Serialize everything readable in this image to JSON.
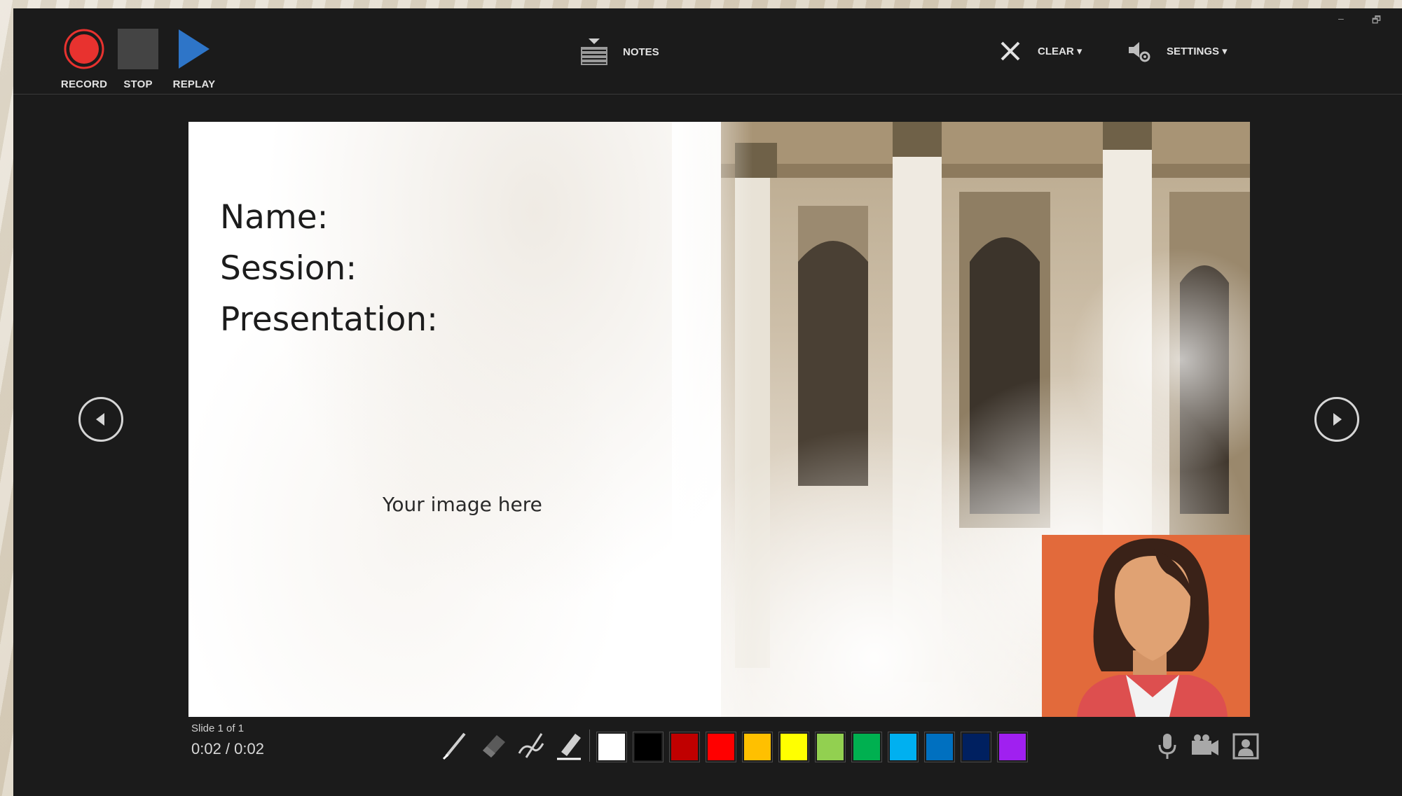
{
  "toolbar": {
    "record_label": "RECORD",
    "stop_label": "STOP",
    "replay_label": "REPLAY",
    "notes_label": "NOTES",
    "clear_label": "CLEAR ▾",
    "settings_label": "SETTINGS ▾"
  },
  "window_controls": {
    "minimize": "–",
    "restore": "🗗"
  },
  "slide": {
    "lines": [
      "Name:",
      "Session:",
      "Presentation:"
    ],
    "image_placeholder": "Your image here"
  },
  "status": {
    "slide_counter": "Slide 1 of 1",
    "time": "0:02  /  0:02"
  },
  "pen_tools": [
    "pen-icon",
    "eraser-icon",
    "laser-pointer-icon",
    "highlighter-icon"
  ],
  "ink_colors": [
    "#ffffff",
    "#000000",
    "#c00000",
    "#ff0000",
    "#ffc000",
    "#ffff00",
    "#92d050",
    "#00b050",
    "#00b0f0",
    "#0070c0",
    "#002060",
    "#a020f0"
  ],
  "media_tools": [
    "microphone-icon",
    "video-camera-icon",
    "camera-preview-icon"
  ],
  "accent": {
    "record_red": "#e8322f",
    "replay_blue": "#2e75c8",
    "camera_bg": "#e26a3b"
  }
}
